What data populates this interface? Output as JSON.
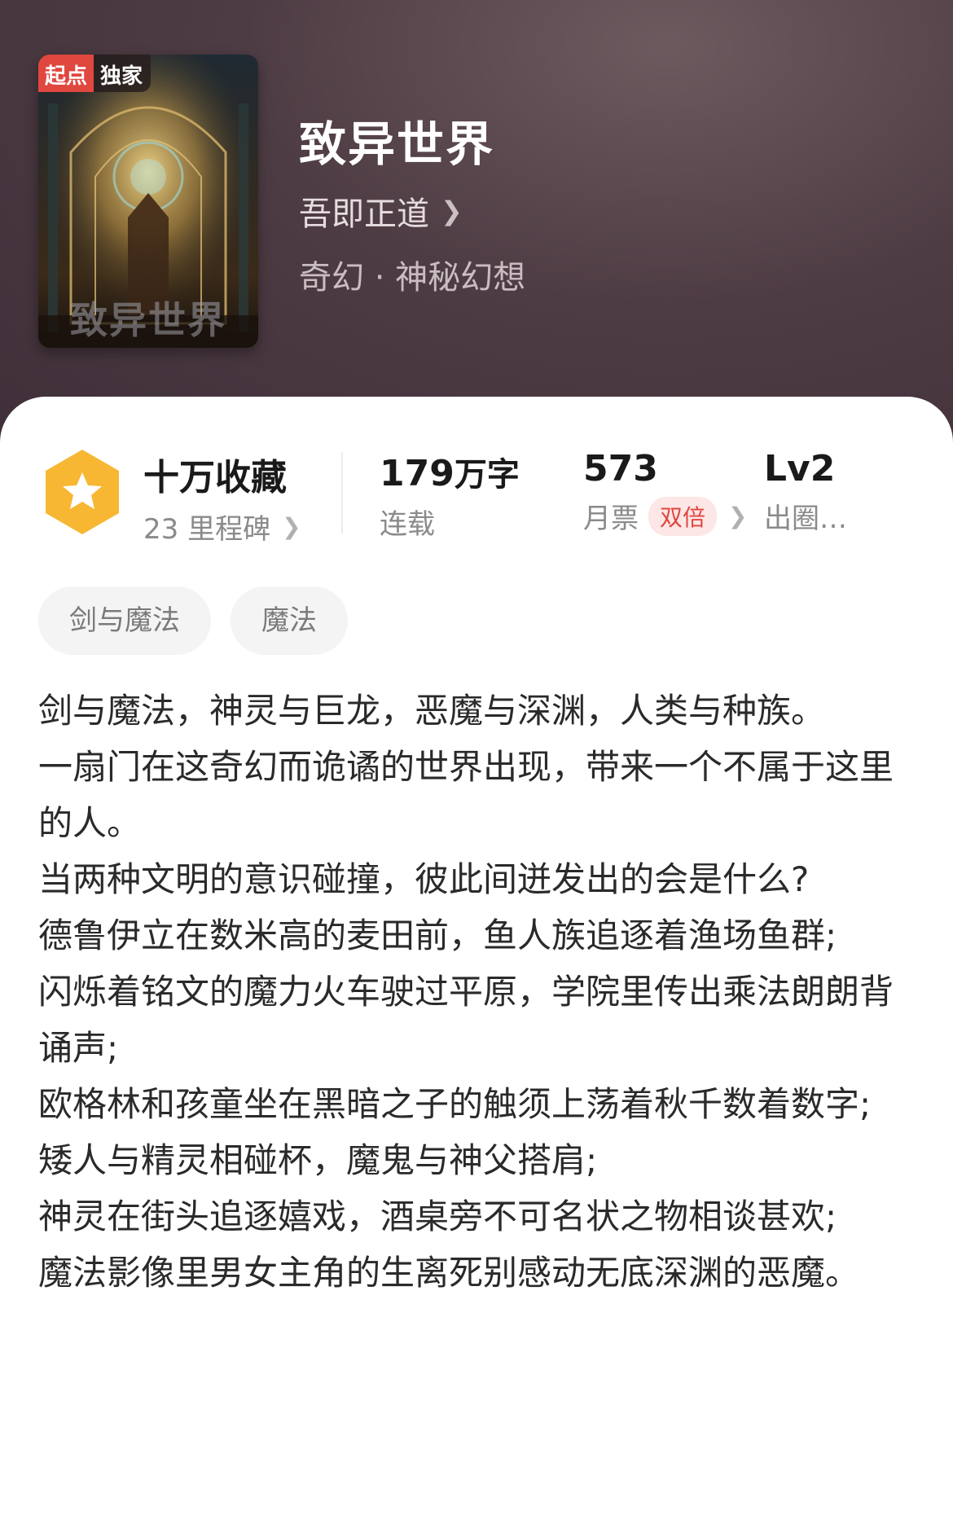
{
  "cover": {
    "badge_left": "起点",
    "badge_right": "独家",
    "title_art": "致异世界"
  },
  "book": {
    "title": "致异世界",
    "author": "吾即正道",
    "genre": "奇幻 · 神秘幻想"
  },
  "stats": {
    "favorites_label": "十万收藏",
    "milestones": "23 里程碑",
    "word_count_value": "179",
    "word_count_unit": "万字",
    "status": "连载",
    "monthly_votes_value": "573",
    "monthly_votes_label": "月票",
    "double_label": "双倍",
    "level_value": "Lv2",
    "level_label": "出圈…"
  },
  "tags": [
    "剑与魔法",
    "魔法"
  ],
  "description": [
    "剑与魔法，神灵与巨龙，恶魔与深渊，人类与种族。",
    "一扇门在这奇幻而诡谲的世界出现，带来一个不属于这里的人。",
    "当两种文明的意识碰撞，彼此间迸发出的会是什么?",
    "德鲁伊立在数米高的麦田前，鱼人族追逐着渔场鱼群;",
    "闪烁着铭文的魔力火车驶过平原，学院里传出乘法朗朗背诵声;",
    "欧格林和孩童坐在黑暗之子的触须上荡着秋千数着数字;",
    "矮人与精灵相碰杯，魔鬼与神父搭肩;",
    "神灵在街头追逐嬉戏，酒桌旁不可名状之物相谈甚欢;",
    "魔法影像里男女主角的生离死别感动无底深渊的恶魔。"
  ],
  "colors": {
    "header_bg": "#4e3c44",
    "accent_red": "#e0473f",
    "badge_gold": "#f7b733"
  }
}
